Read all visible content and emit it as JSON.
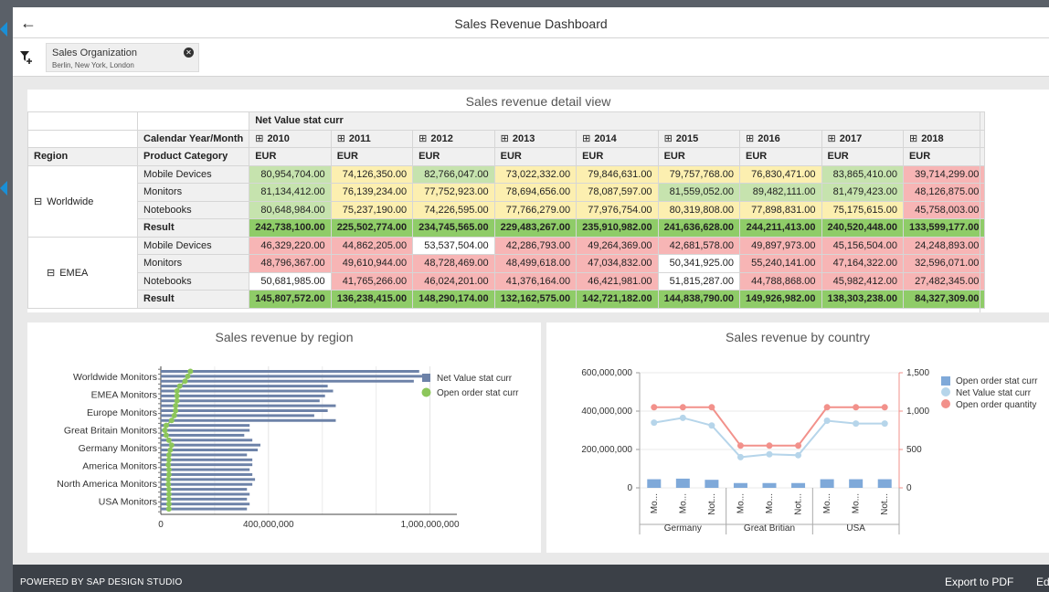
{
  "header": {
    "back_icon": "back-arrow-icon",
    "title": "Sales Revenue Dashboard"
  },
  "filter": {
    "icon": "filter-add-icon",
    "label": "Sales Organization",
    "value": "Berlin, New York, London",
    "close_icon": "close-circle-icon"
  },
  "table": {
    "title": "Sales revenue detail view",
    "measure": "Net Value stat curr",
    "row_dim_header": "Calendar Year/Month",
    "col_header_region": "Region",
    "col_header_category": "Product Category",
    "currency": "EUR",
    "years": [
      "2010",
      "2011",
      "2012",
      "2013",
      "2014",
      "2015",
      "2016",
      "2017",
      "2018"
    ],
    "expand_icon": "expand-box-icon",
    "groups": [
      {
        "region": "Worldwide",
        "rows": [
          {
            "category": "Mobile Devices",
            "values": [
              "80,954,704.00",
              "74,126,350.00",
              "82,766,047.00",
              "73,022,332.00",
              "79,846,631.00",
              "79,757,768.00",
              "76,830,471.00",
              "83,865,410.00",
              "39,714,299.00"
            ],
            "colors": [
              "g",
              "y",
              "g",
              "y",
              "y",
              "y",
              "y",
              "g",
              "r"
            ]
          },
          {
            "category": "Monitors",
            "values": [
              "81,134,412.00",
              "76,139,234.00",
              "77,752,923.00",
              "78,694,656.00",
              "78,087,597.00",
              "81,559,052.00",
              "89,482,111.00",
              "81,479,423.00",
              "48,126,875.00"
            ],
            "colors": [
              "g",
              "y",
              "y",
              "y",
              "y",
              "g",
              "g",
              "g",
              "r"
            ]
          },
          {
            "category": "Notebooks",
            "values": [
              "80,648,984.00",
              "75,237,190.00",
              "74,226,595.00",
              "77,766,279.00",
              "77,976,754.00",
              "80,319,808.00",
              "77,898,831.00",
              "75,175,615.00",
              "45,758,003.00"
            ],
            "colors": [
              "g",
              "y",
              "y",
              "y",
              "y",
              "y",
              "y",
              "y",
              "r"
            ]
          },
          {
            "category": "Result",
            "values": [
              "242,738,100.00",
              "225,502,774.00",
              "234,745,565.00",
              "229,483,267.00",
              "235,910,982.00",
              "241,636,628.00",
              "244,211,413.00",
              "240,520,448.00",
              "133,599,177.00"
            ],
            "colors": [
              "g",
              "g",
              "g",
              "g",
              "g",
              "g",
              "g",
              "g",
              "g"
            ]
          }
        ]
      },
      {
        "region": "EMEA",
        "rows": [
          {
            "category": "Mobile Devices",
            "values": [
              "46,329,220.00",
              "44,862,205.00",
              "53,537,504.00",
              "42,286,793.00",
              "49,264,369.00",
              "42,681,578.00",
              "49,897,973.00",
              "45,156,504.00",
              "24,248,893.00"
            ],
            "colors": [
              "r",
              "r",
              "w",
              "r",
              "r",
              "r",
              "r",
              "r",
              "r"
            ]
          },
          {
            "category": "Monitors",
            "values": [
              "48,796,367.00",
              "49,610,944.00",
              "48,728,469.00",
              "48,499,618.00",
              "47,034,832.00",
              "50,341,925.00",
              "55,240,141.00",
              "47,164,322.00",
              "32,596,071.00"
            ],
            "colors": [
              "r",
              "r",
              "r",
              "r",
              "r",
              "w",
              "r",
              "r",
              "r"
            ]
          },
          {
            "category": "Notebooks",
            "values": [
              "50,681,985.00",
              "41,765,266.00",
              "46,024,201.00",
              "41,376,164.00",
              "46,421,981.00",
              "51,815,287.00",
              "44,788,868.00",
              "45,982,412.00",
              "27,482,345.00"
            ],
            "colors": [
              "w",
              "r",
              "r",
              "r",
              "r",
              "w",
              "r",
              "r",
              "r"
            ]
          },
          {
            "category": "Result",
            "values": [
              "145,807,572.00",
              "136,238,415.00",
              "148,290,174.00",
              "132,162,575.00",
              "142,721,182.00",
              "144,838,790.00",
              "149,926,982.00",
              "138,303,238.00",
              "84,327,309.00"
            ],
            "colors": [
              "g",
              "g",
              "g",
              "g",
              "g",
              "g",
              "g",
              "g",
              "g"
            ]
          }
        ]
      }
    ]
  },
  "chart_data": [
    {
      "type": "bar",
      "title": "Sales revenue by region",
      "orientation": "horizontal",
      "row_labels": [
        "Worldwide  Monitors",
        "EMEA  Monitors",
        "Europe  Monitors",
        "Great Britain  Monitors",
        "Germany  Monitors",
        "America  Monitors",
        "North America  Monitors",
        "USA  Monitors"
      ],
      "series": [
        {
          "name": "Net Value stat curr",
          "color": "#6d82a8",
          "values": [
            960000000,
            1000000000,
            940000000,
            620000000,
            640000000,
            610000000,
            590000000,
            650000000,
            620000000,
            570000000,
            650000000,
            330000000,
            330000000,
            310000000,
            340000000,
            370000000,
            360000000,
            320000000,
            340000000,
            340000000,
            330000000,
            340000000,
            350000000,
            340000000,
            320000000,
            330000000,
            320000000,
            330000000,
            320000000
          ]
        },
        {
          "name": "Open order stat curr",
          "color": "#8cc65b",
          "values": [
            110000000,
            100000000,
            90000000,
            70000000,
            60000000,
            60000000,
            60000000,
            55000000,
            55000000,
            50000000,
            40000000,
            20000000,
            15000000,
            20000000,
            30000000,
            40000000,
            35000000,
            30000000,
            30000000,
            28000000,
            30000000,
            30000000,
            28000000,
            28000000,
            30000000,
            30000000,
            30000000,
            30000000,
            30000000
          ]
        }
      ],
      "xticks": [
        "0",
        "400,000,000",
        "1,000,000,000"
      ],
      "xtick_values": [
        0,
        400000000,
        1000000000
      ],
      "xlim": [
        0,
        1100000000
      ],
      "legend": "top-right"
    },
    {
      "type": "combo",
      "title": "Sales revenue by country",
      "categories": [
        "Mo...",
        "Mo...",
        "Not...",
        "Mo...",
        "Mo...",
        "Not...",
        "Mo...",
        "Mo...",
        "Not..."
      ],
      "groups": [
        "Germany",
        "Great Britian",
        "USA"
      ],
      "left_ticks": [
        "600,000,000",
        "400,000,000",
        "200,000,000",
        "0"
      ],
      "left_tick_values": [
        600000000,
        400000000,
        200000000,
        0
      ],
      "right_ticks": [
        "1,500",
        "1,000",
        "500",
        "0"
      ],
      "right_tick_values": [
        1500,
        1000,
        500,
        0
      ],
      "ylim_left": [
        0,
        600000000
      ],
      "ylim_right": [
        0,
        1500
      ],
      "series": [
        {
          "name": "Open order stat curr",
          "kind": "bar",
          "axis": "left",
          "color": "#7fa9d9",
          "values": [
            45000000,
            48000000,
            42000000,
            25000000,
            25000000,
            25000000,
            45000000,
            45000000,
            45000000
          ]
        },
        {
          "name": "Net Value stat curr",
          "kind": "line",
          "axis": "left",
          "color": "#b6d5ea",
          "values": [
            340000000,
            365000000,
            325000000,
            160000000,
            175000000,
            170000000,
            350000000,
            335000000,
            335000000
          ]
        },
        {
          "name": "Open order quantity",
          "kind": "line",
          "axis": "right",
          "color": "#f2918b",
          "values": [
            1050,
            1050,
            1050,
            550,
            550,
            550,
            1050,
            1050,
            1050
          ]
        }
      ],
      "legend": "top-right"
    }
  ],
  "footer": {
    "powered": "POWERED BY SAP DESIGN STUDIO",
    "export": "Export to PDF",
    "edit": "Ed"
  }
}
